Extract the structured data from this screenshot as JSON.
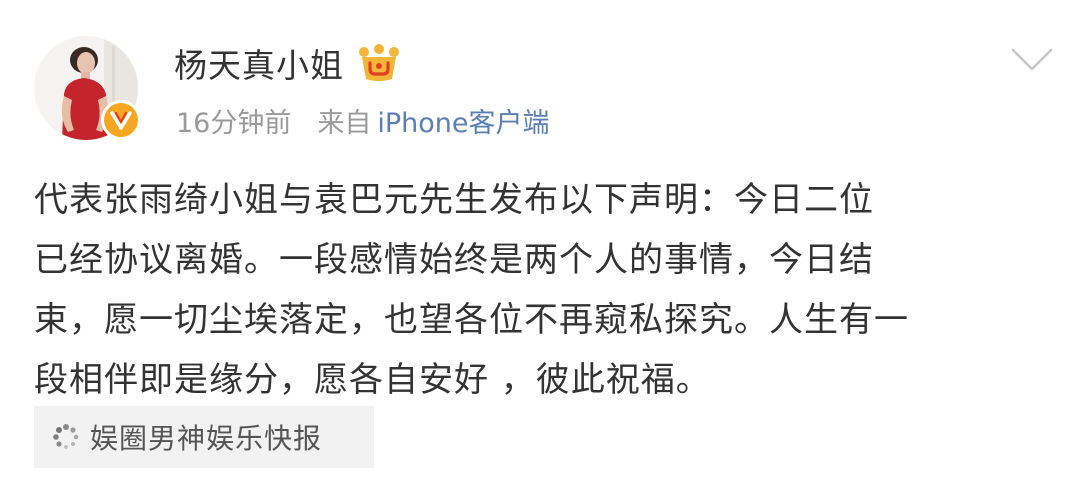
{
  "post": {
    "author": {
      "name": "杨天真小姐",
      "avatar_icon": "portrait-avatar",
      "verified_icon": "orange-verified-v-icon",
      "vip_icon": "gold-crown-vip-icon"
    },
    "time": "16分钟前",
    "from_label": "来自",
    "source": "iPhone客户端",
    "text": "代表张雨绮小姐与袁巴元先生发布以下声明：今日二位\n已经协议离婚。一段感情始终是两个人的事情，今日结\n束，愿一切尘埃落定，也望各位不再窥私探究。人生有一\n段相伴即是缘分，愿各自安好 ，彼此祝福。",
    "topic": {
      "label": "娱圈男神娱乐快报",
      "icon": "spinner-icon"
    },
    "menu_icon": "chevron-down-icon"
  },
  "colors": {
    "text": "#333333",
    "meta": "#9a9a9a",
    "link": "#5d7faf",
    "verified": "#f5a623",
    "vip_crown": "#f3b53a",
    "tag_background": "#f2f2f2"
  }
}
